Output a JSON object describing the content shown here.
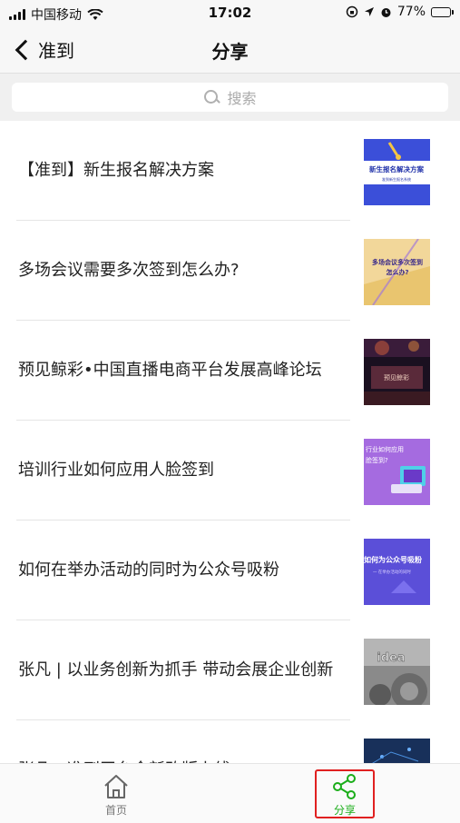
{
  "status_bar": {
    "carrier": "中国移动",
    "time": "17:02",
    "battery": "77%",
    "battery_level": 0.77
  },
  "nav": {
    "back_label": "准到",
    "title": "分享"
  },
  "search": {
    "placeholder": "搜索"
  },
  "articles": [
    {
      "title": "【准到】新生报名解决方案",
      "thumb_text": [
        "新生报名解决方案",
        "准到新生报名系统"
      ]
    },
    {
      "title": "多场会议需要多次签到怎么办?",
      "thumb_text": [
        "多场会议多次签到",
        "怎么办?"
      ]
    },
    {
      "title": "预见鲸彩•中国直播电商平台发展高峰论坛",
      "thumb_text": [
        "预见鲸彩"
      ]
    },
    {
      "title": "培训行业如何应用人脸签到",
      "thumb_text": [
        "行业如何应用",
        "脸签到?"
      ]
    },
    {
      "title": "如何在举办活动的同时为公众号吸粉",
      "thumb_text": [
        "如何为公众号吸粉",
        "一 在举办活动的同时"
      ]
    },
    {
      "title": "张凡 | 以业务创新为抓手 带动会展企业创新",
      "thumb_text": [
        "idea"
      ]
    },
    {
      "title": "张凡：准到平台全新改版上线",
      "thumb_text": []
    }
  ],
  "tabs": [
    {
      "label": "首页",
      "icon": "home-icon"
    },
    {
      "label": "分享",
      "icon": "share-icon",
      "active": true
    }
  ],
  "colors": {
    "accent": "#1aad19",
    "highlight": "#e02020"
  }
}
